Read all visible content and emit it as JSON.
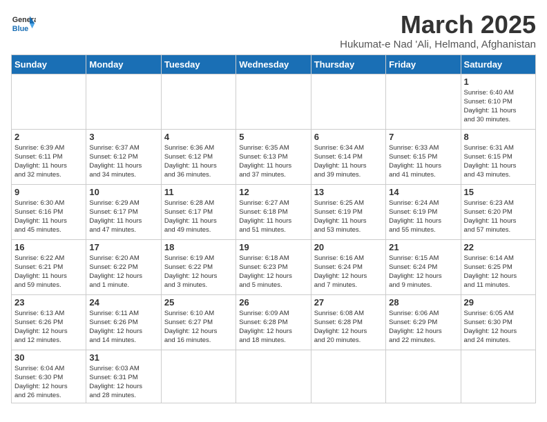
{
  "header": {
    "logo_general": "General",
    "logo_blue": "Blue",
    "month_title": "March 2025",
    "subtitle": "Hukumat-e Nad 'Ali, Helmand, Afghanistan"
  },
  "weekdays": [
    "Sunday",
    "Monday",
    "Tuesday",
    "Wednesday",
    "Thursday",
    "Friday",
    "Saturday"
  ],
  "days": [
    {
      "num": "",
      "content": ""
    },
    {
      "num": "",
      "content": ""
    },
    {
      "num": "",
      "content": ""
    },
    {
      "num": "",
      "content": ""
    },
    {
      "num": "",
      "content": ""
    },
    {
      "num": "",
      "content": ""
    },
    {
      "num": "1",
      "content": "Sunrise: 6:40 AM\nSunset: 6:10 PM\nDaylight: 11 hours\nand 30 minutes."
    },
    {
      "num": "2",
      "content": "Sunrise: 6:39 AM\nSunset: 6:11 PM\nDaylight: 11 hours\nand 32 minutes."
    },
    {
      "num": "3",
      "content": "Sunrise: 6:37 AM\nSunset: 6:12 PM\nDaylight: 11 hours\nand 34 minutes."
    },
    {
      "num": "4",
      "content": "Sunrise: 6:36 AM\nSunset: 6:12 PM\nDaylight: 11 hours\nand 36 minutes."
    },
    {
      "num": "5",
      "content": "Sunrise: 6:35 AM\nSunset: 6:13 PM\nDaylight: 11 hours\nand 37 minutes."
    },
    {
      "num": "6",
      "content": "Sunrise: 6:34 AM\nSunset: 6:14 PM\nDaylight: 11 hours\nand 39 minutes."
    },
    {
      "num": "7",
      "content": "Sunrise: 6:33 AM\nSunset: 6:15 PM\nDaylight: 11 hours\nand 41 minutes."
    },
    {
      "num": "8",
      "content": "Sunrise: 6:31 AM\nSunset: 6:15 PM\nDaylight: 11 hours\nand 43 minutes."
    },
    {
      "num": "9",
      "content": "Sunrise: 6:30 AM\nSunset: 6:16 PM\nDaylight: 11 hours\nand 45 minutes."
    },
    {
      "num": "10",
      "content": "Sunrise: 6:29 AM\nSunset: 6:17 PM\nDaylight: 11 hours\nand 47 minutes."
    },
    {
      "num": "11",
      "content": "Sunrise: 6:28 AM\nSunset: 6:17 PM\nDaylight: 11 hours\nand 49 minutes."
    },
    {
      "num": "12",
      "content": "Sunrise: 6:27 AM\nSunset: 6:18 PM\nDaylight: 11 hours\nand 51 minutes."
    },
    {
      "num": "13",
      "content": "Sunrise: 6:25 AM\nSunset: 6:19 PM\nDaylight: 11 hours\nand 53 minutes."
    },
    {
      "num": "14",
      "content": "Sunrise: 6:24 AM\nSunset: 6:19 PM\nDaylight: 11 hours\nand 55 minutes."
    },
    {
      "num": "15",
      "content": "Sunrise: 6:23 AM\nSunset: 6:20 PM\nDaylight: 11 hours\nand 57 minutes."
    },
    {
      "num": "16",
      "content": "Sunrise: 6:22 AM\nSunset: 6:21 PM\nDaylight: 11 hours\nand 59 minutes."
    },
    {
      "num": "17",
      "content": "Sunrise: 6:20 AM\nSunset: 6:22 PM\nDaylight: 12 hours\nand 1 minute."
    },
    {
      "num": "18",
      "content": "Sunrise: 6:19 AM\nSunset: 6:22 PM\nDaylight: 12 hours\nand 3 minutes."
    },
    {
      "num": "19",
      "content": "Sunrise: 6:18 AM\nSunset: 6:23 PM\nDaylight: 12 hours\nand 5 minutes."
    },
    {
      "num": "20",
      "content": "Sunrise: 6:16 AM\nSunset: 6:24 PM\nDaylight: 12 hours\nand 7 minutes."
    },
    {
      "num": "21",
      "content": "Sunrise: 6:15 AM\nSunset: 6:24 PM\nDaylight: 12 hours\nand 9 minutes."
    },
    {
      "num": "22",
      "content": "Sunrise: 6:14 AM\nSunset: 6:25 PM\nDaylight: 12 hours\nand 11 minutes."
    },
    {
      "num": "23",
      "content": "Sunrise: 6:13 AM\nSunset: 6:26 PM\nDaylight: 12 hours\nand 12 minutes."
    },
    {
      "num": "24",
      "content": "Sunrise: 6:11 AM\nSunset: 6:26 PM\nDaylight: 12 hours\nand 14 minutes."
    },
    {
      "num": "25",
      "content": "Sunrise: 6:10 AM\nSunset: 6:27 PM\nDaylight: 12 hours\nand 16 minutes."
    },
    {
      "num": "26",
      "content": "Sunrise: 6:09 AM\nSunset: 6:28 PM\nDaylight: 12 hours\nand 18 minutes."
    },
    {
      "num": "27",
      "content": "Sunrise: 6:08 AM\nSunset: 6:28 PM\nDaylight: 12 hours\nand 20 minutes."
    },
    {
      "num": "28",
      "content": "Sunrise: 6:06 AM\nSunset: 6:29 PM\nDaylight: 12 hours\nand 22 minutes."
    },
    {
      "num": "29",
      "content": "Sunrise: 6:05 AM\nSunset: 6:30 PM\nDaylight: 12 hours\nand 24 minutes."
    },
    {
      "num": "30",
      "content": "Sunrise: 6:04 AM\nSunset: 6:30 PM\nDaylight: 12 hours\nand 26 minutes."
    },
    {
      "num": "31",
      "content": "Sunrise: 6:03 AM\nSunset: 6:31 PM\nDaylight: 12 hours\nand 28 minutes."
    },
    {
      "num": "",
      "content": ""
    },
    {
      "num": "",
      "content": ""
    },
    {
      "num": "",
      "content": ""
    },
    {
      "num": "",
      "content": ""
    },
    {
      "num": "",
      "content": ""
    }
  ]
}
